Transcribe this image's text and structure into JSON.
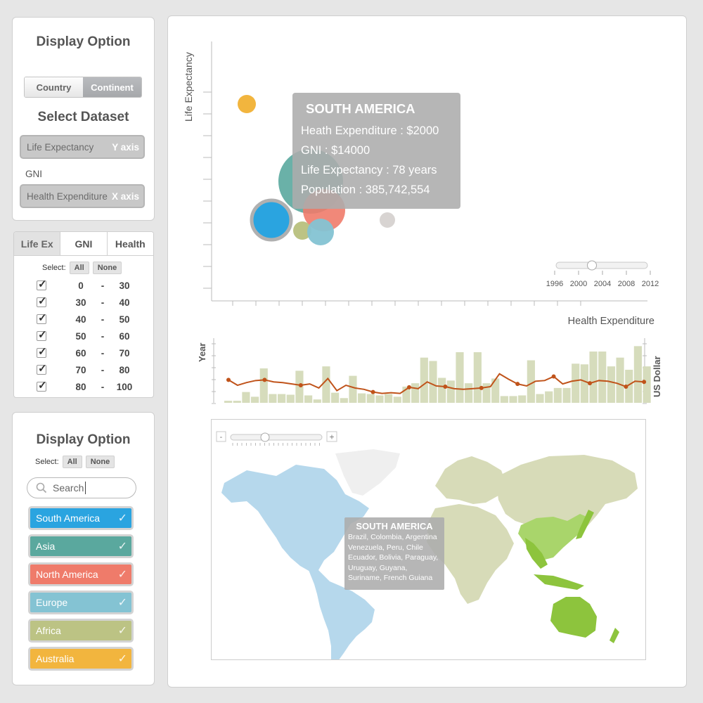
{
  "display_panel": {
    "title": "Display Option",
    "toggle": [
      "Country",
      "Continent"
    ],
    "dataset_title": "Select Dataset",
    "datasets": [
      {
        "label": "Life Expectancy",
        "axis": "Y axis"
      },
      {
        "label": "GNI",
        "axis": ""
      },
      {
        "label": "Health Expenditure",
        "axis": "X axis"
      }
    ]
  },
  "filter_panel": {
    "tabs": [
      "Life Ex",
      "GNI",
      "Health"
    ],
    "select_label": "Select:",
    "all_label": "All",
    "none_label": "None",
    "ranges": [
      {
        "from": "0",
        "to": "30"
      },
      {
        "from": "30",
        "to": "40"
      },
      {
        "from": "40",
        "to": "50"
      },
      {
        "from": "50",
        "to": "60"
      },
      {
        "from": "60",
        "to": "70"
      },
      {
        "from": "70",
        "to": "80"
      },
      {
        "from": "80",
        "to": "100"
      }
    ],
    "dash": "-"
  },
  "continent_panel": {
    "title": "Display Option",
    "select_label": "Select:",
    "all_label": "All",
    "none_label": "None",
    "search_placeholder": "Search",
    "items": [
      {
        "label": "South America",
        "color": "#2aa4e0"
      },
      {
        "label": "Asia",
        "color": "#5aa89e"
      },
      {
        "label": "North America",
        "color": "#ef7b6a"
      },
      {
        "label": "Europe",
        "color": "#84c3d3"
      },
      {
        "label": "Africa",
        "color": "#bcc384"
      },
      {
        "label": "Australia",
        "color": "#f2b53e"
      }
    ]
  },
  "scatter": {
    "ylabel": "Life Expectancy",
    "xlabel": "Health Expenditure",
    "years": [
      "1996",
      "2000",
      "2004",
      "2008",
      "2012"
    ],
    "tooltip": {
      "title": "SOUTH AMERICA",
      "lines": [
        "Heath Expenditure : $2000",
        "GNI : $14000",
        "Life Expectancy : 78 years",
        "Population : 385,742,554"
      ]
    }
  },
  "timeline": {
    "left_label": "Year",
    "right_label": "US Dollar",
    "bars": [
      0.06,
      0.06,
      0.32,
      0.18,
      1.02,
      0.26,
      0.26,
      0.24,
      0.95,
      0.22,
      0.1,
      1.08,
      0.3,
      0.14,
      0.8,
      0.28,
      0.26,
      0.22,
      0.26,
      0.18,
      0.48,
      0.58,
      1.34,
      1.24,
      0.74,
      0.66,
      1.5,
      0.58,
      1.5,
      0.58,
      0.72,
      0.2,
      0.2,
      0.22,
      1.26,
      0.26,
      0.34,
      0.44,
      0.44,
      1.16,
      1.14,
      1.52,
      1.52,
      1.08,
      1.34,
      0.98,
      1.68,
      1.08
    ],
    "line": [
      0.68,
      0.52,
      0.6,
      0.66,
      0.68,
      0.62,
      0.6,
      0.56,
      0.52,
      0.56,
      0.44,
      0.72,
      0.36,
      0.52,
      0.44,
      0.4,
      0.32,
      0.28,
      0.3,
      0.28,
      0.46,
      0.42,
      0.62,
      0.5,
      0.48,
      0.42,
      0.4,
      0.42,
      0.44,
      0.48,
      0.86,
      0.7,
      0.56,
      0.5,
      0.64,
      0.66,
      0.78,
      0.56,
      0.64,
      0.68,
      0.58,
      0.66,
      0.64,
      0.58,
      0.48,
      0.64,
      0.62
    ]
  },
  "map": {
    "minus": "-",
    "plus": "+",
    "tooltip": {
      "title": "SOUTH AMERICA",
      "lines": [
        "Brazil, Colombia, Argentina",
        "Venezuela, Peru, Chile",
        "Ecuador, Bolivia, Paraguay,",
        "Uruguay, Guyana,",
        "Suriname, French Guiana"
      ]
    }
  }
}
